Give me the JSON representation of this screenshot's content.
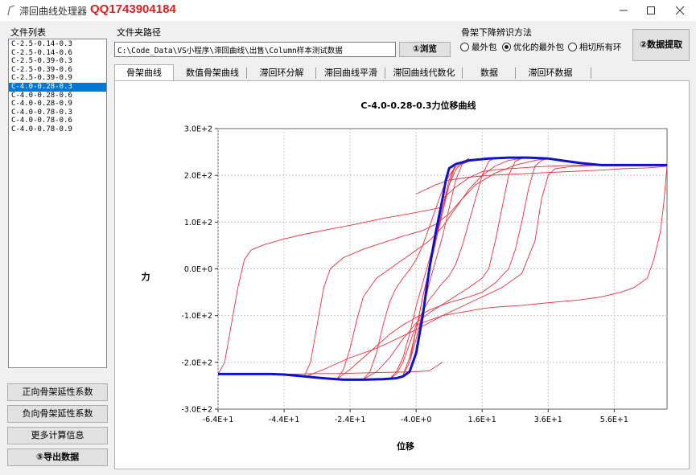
{
  "window": {
    "title": "滞回曲线处理器",
    "watermark": "QQ1743904184",
    "minimize_icon": "minimize-icon",
    "maximize_icon": "maximize-icon",
    "close_icon": "close-icon"
  },
  "left_panel": {
    "file_list_label": "文件列表",
    "files": [
      "C-2.5-0.14-0.3",
      "C-2.5-0.14-0.6",
      "C-2.5-0.39-0.3",
      "C-2.5-0.39-0.6",
      "C-2.5-0.39-0.9",
      "C-4.0-0.28-0.3",
      "C-4.0-0.28-0.6",
      "C-4.0-0.28-0.9",
      "C-4.0-0.78-0.3",
      "C-4.0-0.78-0.6",
      "C-4.0-0.78-0.9"
    ],
    "selected_index": 5,
    "buttons": {
      "pos_ductility": "正向骨架延性系数",
      "neg_ductility": "负向骨架延性系数",
      "more_info": "更多计算信息",
      "export": "⑤导出数据"
    }
  },
  "path": {
    "label": "文件夹路径",
    "value": "C:\\Code_Data\\VS小程序\\滞回曲线\\出售\\Column样本测试数据",
    "browse_label": "①浏览"
  },
  "method": {
    "label": "骨架下降辨识方法",
    "options": [
      "最外包",
      "优化的最外包",
      "相切所有环"
    ],
    "selected_index": 1
  },
  "extract_label": "②数据提取",
  "tabs": [
    "骨架曲线",
    "数值骨架曲线",
    "滞回环分解",
    "滞回曲线平滑",
    "滞回曲线代数化",
    "数据",
    "滞回环数据"
  ],
  "active_tab": 0,
  "chart_data": {
    "type": "line",
    "title": "C-4.0-0.28-0.3力位移曲线",
    "xlabel": "位移",
    "ylabel": "力",
    "xlim": [
      -64,
      72
    ],
    "ylim": [
      -300,
      300
    ],
    "x_ticks": [
      -64,
      -44,
      -24,
      -4,
      16,
      36,
      56
    ],
    "x_tick_labels": [
      "-6.4E+1",
      "-4.4E+1",
      "-2.4E+1",
      "-4.0E+0",
      "1.6E+1",
      "3.6E+1",
      "5.6E+1"
    ],
    "y_ticks": [
      300,
      200,
      100,
      0,
      -100,
      -200,
      -300
    ],
    "y_tick_labels": [
      "3.0E+2",
      "2.0E+2",
      "1.0E+2",
      "0.0E+0",
      "-1.0E+2",
      "-2.0E+2",
      "-3.0E+2"
    ],
    "grid": true,
    "hysteresis_color": "#e8323c",
    "skeleton_color": "#1010d0",
    "series": [
      {
        "kind": "hysteresis",
        "x": [
          -4,
          0,
          4,
          8,
          12,
          16,
          20,
          24,
          28,
          34,
          40,
          46,
          52,
          58,
          62,
          66,
          68,
          70,
          71,
          72,
          70,
          66,
          62,
          58,
          54,
          48,
          42,
          36,
          30,
          24,
          18,
          12,
          6,
          2,
          -4
        ],
        "y": [
          -120,
          -110,
          -100,
          -95,
          -90,
          -85,
          -82,
          -80,
          -78,
          -74,
          -70,
          -66,
          -60,
          -50,
          -40,
          -20,
          20,
          80,
          140,
          220,
          218,
          216,
          215,
          214,
          212,
          210,
          208,
          206,
          204,
          202,
          200,
          196,
          190,
          180,
          160
        ]
      },
      {
        "kind": "hysteresis",
        "x": [
          -64,
          -60,
          -56,
          -52,
          -48,
          -44,
          -40,
          -34,
          -28,
          -22,
          -16,
          -10,
          -4,
          0,
          4
        ],
        "y": [
          -225,
          -225,
          -225,
          -225,
          -225,
          -225,
          -225,
          -224,
          -224,
          -223,
          -222,
          -221,
          -220,
          -218,
          -200
        ]
      },
      {
        "kind": "hysteresis",
        "x": [
          -64,
          -62,
          -60,
          -58,
          -56,
          -54,
          -50,
          -44,
          -38,
          -30,
          -22,
          -14,
          -6,
          0,
          4
        ],
        "y": [
          -225,
          -200,
          -120,
          -40,
          20,
          40,
          52,
          64,
          74,
          85,
          96,
          108,
          118,
          126,
          132
        ]
      },
      {
        "kind": "hysteresis",
        "x": [
          4,
          8,
          12,
          16,
          20,
          26,
          32,
          38,
          44,
          48,
          52,
          54
        ],
        "y": [
          150,
          175,
          195,
          208,
          212,
          215,
          218,
          220,
          222,
          222,
          222,
          222
        ]
      },
      {
        "kind": "hysteresis",
        "x": [
          54,
          50,
          46,
          42,
          38,
          36,
          34,
          32,
          28,
          22,
          16,
          10,
          4,
          0,
          -4,
          -10,
          -16,
          -24,
          -32,
          -38
        ],
        "y": [
          222,
          221,
          220,
          218,
          214,
          200,
          150,
          60,
          -10,
          -40,
          -60,
          -80,
          -100,
          -115,
          -130,
          -150,
          -170,
          -190,
          -215,
          -232
        ]
      },
      {
        "kind": "hysteresis",
        "x": [
          -38,
          -36,
          -34,
          -32,
          -30,
          -26,
          -20,
          -14,
          -8,
          -2,
          2,
          6,
          10,
          14,
          20,
          26,
          32,
          36
        ],
        "y": [
          -232,
          -200,
          -120,
          -40,
          0,
          24,
          42,
          56,
          70,
          82,
          96,
          118,
          150,
          180,
          205,
          222,
          232,
          236
        ]
      },
      {
        "kind": "hysteresis",
        "x": [
          36,
          34,
          32,
          30,
          28,
          26,
          24,
          20,
          16,
          12,
          6,
          0,
          -4,
          -8,
          -12,
          -16,
          -20,
          -24,
          -28
        ],
        "y": [
          236,
          232,
          220,
          170,
          100,
          40,
          0,
          -30,
          -50,
          -60,
          -72,
          -88,
          -104,
          -120,
          -140,
          -165,
          -190,
          -215,
          -236
        ]
      },
      {
        "kind": "hysteresis",
        "x": [
          -28,
          -26,
          -24,
          -22,
          -20,
          -16,
          -12,
          -8,
          -4,
          0,
          4,
          8,
          12,
          16,
          20,
          24,
          28
        ],
        "y": [
          -236,
          -215,
          -170,
          -110,
          -60,
          -20,
          0,
          20,
          40,
          60,
          90,
          130,
          170,
          200,
          220,
          232,
          236
        ]
      },
      {
        "kind": "hysteresis",
        "x": [
          28,
          26,
          24,
          22,
          20,
          18,
          16,
          12,
          8,
          4,
          0,
          -4,
          -8,
          -12,
          -16,
          -20
        ],
        "y": [
          236,
          230,
          200,
          130,
          60,
          0,
          -20,
          -40,
          -58,
          -76,
          -94,
          -116,
          -150,
          -190,
          -220,
          -236
        ]
      },
      {
        "kind": "hysteresis",
        "x": [
          -20,
          -18,
          -16,
          -14,
          -12,
          -10,
          -8,
          -6,
          -4,
          -2,
          0,
          2,
          4,
          6,
          8,
          12,
          16,
          20
        ],
        "y": [
          -236,
          -220,
          -180,
          -120,
          -70,
          -40,
          -20,
          -2,
          20,
          50,
          90,
          130,
          170,
          200,
          218,
          230,
          236,
          238
        ]
      },
      {
        "kind": "hysteresis",
        "x": [
          20,
          18,
          16,
          14,
          12,
          10,
          8,
          6,
          4,
          2,
          0,
          -2,
          -4,
          -6,
          -8,
          -10,
          -12
        ],
        "y": [
          238,
          230,
          200,
          150,
          100,
          50,
          10,
          -15,
          -30,
          -48,
          -66,
          -90,
          -120,
          -160,
          -200,
          -225,
          -235
        ]
      },
      {
        "kind": "hysteresis",
        "x": [
          -12,
          -10,
          -8,
          -6,
          -4,
          -2,
          0,
          2,
          4,
          6,
          8,
          10,
          12
        ],
        "y": [
          -235,
          -220,
          -190,
          -140,
          -80,
          -30,
          20,
          70,
          130,
          180,
          212,
          228,
          236
        ]
      },
      {
        "kind": "hysteresis",
        "x": [
          12,
          10,
          8,
          6,
          4,
          2,
          0,
          -2,
          -4,
          -6,
          -8
        ],
        "y": [
          236,
          225,
          190,
          130,
          70,
          20,
          -30,
          -90,
          -150,
          -200,
          -228
        ]
      },
      {
        "kind": "hysteresis",
        "x": [
          -8,
          -6,
          -4,
          -2,
          0,
          2,
          4,
          6,
          8
        ],
        "y": [
          -228,
          -190,
          -130,
          -60,
          0,
          60,
          130,
          190,
          225
        ]
      },
      {
        "kind": "hysteresis",
        "x": [
          8,
          6,
          4,
          2,
          0,
          -2,
          -4,
          -6
        ],
        "y": [
          225,
          180,
          120,
          60,
          0,
          -60,
          -130,
          -200
        ]
      },
      {
        "kind": "skeleton",
        "x": [
          -64,
          -60,
          -54,
          -48,
          -44,
          -38,
          -32,
          -26,
          -20,
          -14,
          -10,
          -8,
          -6,
          -4,
          -2,
          0,
          2,
          4,
          5,
          6,
          8,
          12,
          18,
          24,
          30,
          36,
          40,
          46,
          52,
          58,
          64,
          70,
          72
        ],
        "y": [
          -225,
          -225,
          -225,
          -225,
          -226,
          -230,
          -234,
          -237,
          -237,
          -236,
          -234,
          -230,
          -220,
          -180,
          -100,
          0,
          80,
          150,
          190,
          215,
          224,
          232,
          236,
          238,
          238,
          236,
          232,
          226,
          222,
          222,
          222,
          222,
          222
        ]
      }
    ]
  }
}
